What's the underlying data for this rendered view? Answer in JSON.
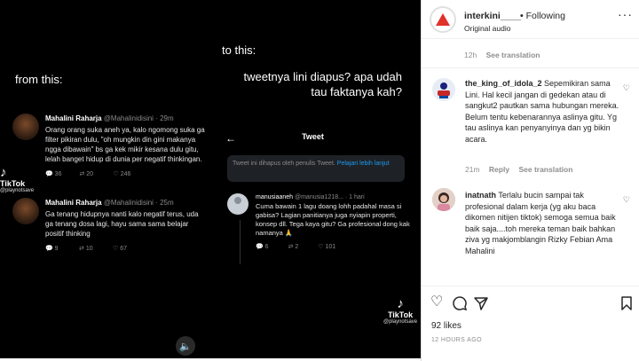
{
  "video": {
    "caption_from": "from this:",
    "caption_to": "to this:",
    "caption_question": "tweetnya lini diapus? apa udah tau faktanya kah?",
    "tiktok_brand": "TikTok",
    "tiktok_user": "@playnotsave",
    "mute_icon": "speaker-icon",
    "tweets_left": [
      {
        "name": "Mahalini Raharja",
        "handle": "@Mahalinidisini · 29m",
        "text": "Orang orang suka aneh ya, kalo ngomong suka ga filter pikiran dulu, \"oh mungkin din gini makanya ngga dibawain\" bs ga kek mikir kesana dulu gitu, lelah banget hidup di dunia per negatif thinkingan.",
        "replies": "36",
        "retweets": "20",
        "likes": "246"
      },
      {
        "name": "Mahalini Raharja",
        "handle": "@Mahalinidisini · 25m",
        "text": "Ga tenang hidupnya nanti kalo negatif terus, uda ga tenang dosa lagi, hayu sama sama belajar positif thinking",
        "replies": "9",
        "retweets": "10",
        "likes": "67"
      }
    ],
    "phone": {
      "title": "Tweet",
      "deleted_notice": "Tweet ini dihapus oleh penulis Tweet.",
      "deleted_link": "Pelajari lebih lanjut",
      "reply_name": "manusiaaneh",
      "reply_handle": "@manusia1218... · 1 hari",
      "reply_text": "Cuma bawain 1 lagu doang lohh padahal masa si gabisa? Lagian panitianya juga nyiapin properti, konsep dll. Tega kaya gitu? Ga profesional dong kak namanya 🙏",
      "replies": "6",
      "retweets": "2",
      "likes": "101"
    }
  },
  "instagram": {
    "username": "interkini____",
    "follow_status": "Following",
    "audio": "Original audio",
    "top_meta_time": "12h",
    "top_meta_action": "See translation",
    "comments": [
      {
        "user": "the_king_of_idola_2",
        "text": "Sepemikiran sama Lini. Hal kecil jangan di gedekan atau di sangkut2 pautkan sama hubungan mereka. Belum tentu kebenarannya aslinya gitu. Yg tau aslinya kan penyanyinya dan yg bikin acara.",
        "time": "21m",
        "reply": "Reply",
        "translate": "See translation"
      },
      {
        "user": "inatnath",
        "text": "Terlalu bucin sampai tak profesional dalam kerja (yg aku baca dikomen nitijen tiktok) semoga semua baik baik saja....toh mereka teman baik bahkan ziva yg makjomblangin Rizky Febian Ama Mahalini"
      }
    ],
    "likes": "92 likes",
    "date": "12 HOURS AGO"
  },
  "colors": {
    "instagram_text": "#262626",
    "instagram_meta": "#8e8e8e",
    "twitter_link": "#1d9bf0",
    "logo_red": "#e0322b"
  }
}
